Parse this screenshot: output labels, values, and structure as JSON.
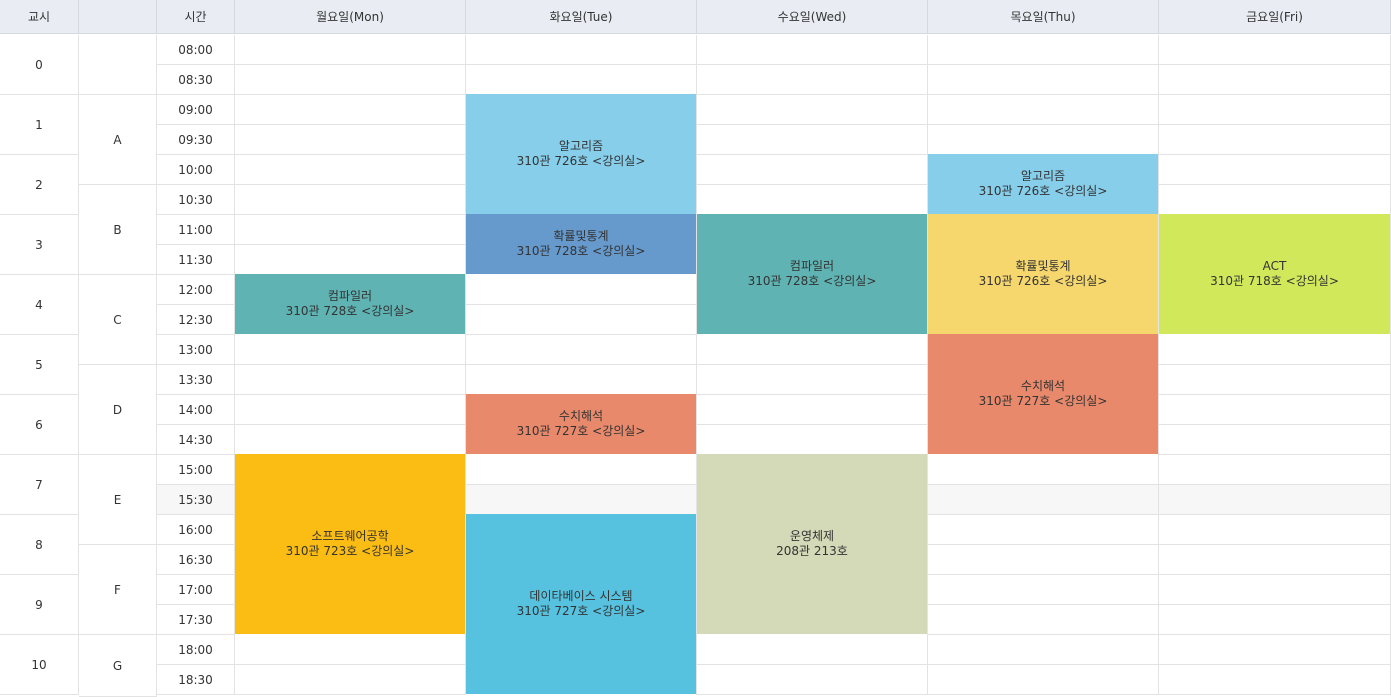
{
  "headers": {
    "period": "교시",
    "block": "",
    "time": "시간",
    "days": [
      "월요일(Mon)",
      "화요일(Tue)",
      "수요일(Wed)",
      "목요일(Thu)",
      "금요일(Fri)"
    ]
  },
  "periods": [
    "0",
    "1",
    "2",
    "3",
    "4",
    "5",
    "6",
    "7",
    "8",
    "9",
    "10"
  ],
  "blocks": [
    "A",
    "B",
    "C",
    "D",
    "E",
    "F",
    "G"
  ],
  "times": [
    "08:00",
    "08:30",
    "09:00",
    "09:30",
    "10:00",
    "10:30",
    "11:00",
    "11:30",
    "12:00",
    "12:30",
    "13:00",
    "13:30",
    "14:00",
    "14:30",
    "15:00",
    "15:30",
    "16:00",
    "16:30",
    "17:00",
    "17:30",
    "18:00",
    "18:30"
  ],
  "courses": [
    {
      "name": "알고리즘",
      "room": "310관 726호 <강의실>",
      "day": 1,
      "start": 2,
      "span": 4,
      "color": "#87ceeb"
    },
    {
      "name": "확률및통계",
      "room": "310관 728호 <강의실>",
      "day": 1,
      "start": 6,
      "span": 2,
      "color": "#6699cc"
    },
    {
      "name": "수치해석",
      "room": "310관 727호 <강의실>",
      "day": 1,
      "start": 12,
      "span": 2,
      "color": "#e8896b"
    },
    {
      "name": "데이타베이스 시스템",
      "room": "310관 727호 <강의실>",
      "day": 1,
      "start": 16,
      "span": 6,
      "color": "#56c2e0"
    },
    {
      "name": "컴파일러",
      "room": "310관 728호 <강의실>",
      "day": 0,
      "start": 8,
      "span": 2,
      "color": "#5fb3b3"
    },
    {
      "name": "소프트웨어공학",
      "room": "310관 723호 <강의실>",
      "day": 0,
      "start": 14,
      "span": 6,
      "color": "#fbbd13"
    },
    {
      "name": "컴파일러",
      "room": "310관 728호 <강의실>",
      "day": 2,
      "start": 6,
      "span": 4,
      "color": "#5fb3b3"
    },
    {
      "name": "운영체제",
      "room": "208관 213호",
      "day": 2,
      "start": 14,
      "span": 6,
      "color": "#d4d9b8"
    },
    {
      "name": "알고리즘",
      "room": "310관 726호 <강의실>",
      "day": 3,
      "start": 4,
      "span": 2,
      "color": "#87ceeb"
    },
    {
      "name": "확률및통계",
      "room": "310관 726호 <강의실>",
      "day": 3,
      "start": 6,
      "span": 4,
      "color": "#f5d76e"
    },
    {
      "name": "수치해석",
      "room": "310관 727호 <강의실>",
      "day": 3,
      "start": 10,
      "span": 4,
      "color": "#e8896b"
    },
    {
      "name": "ACT",
      "room": "310관 718호 <강의실>",
      "day": 4,
      "start": 6,
      "span": 4,
      "color": "#d0e85a"
    }
  ]
}
